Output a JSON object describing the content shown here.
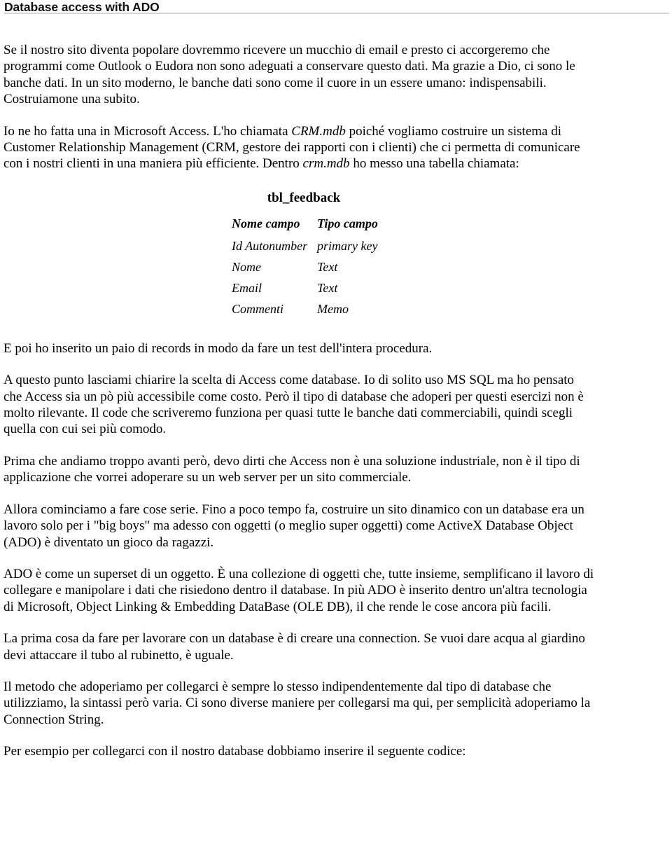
{
  "header": {
    "title": "Database access with ADO",
    "rule_color": "#d4d4d4"
  },
  "document": {
    "paragraphs": [
      {
        "id": "intro",
        "runs": [
          {
            "text": "Se il nostro sito diventa popolare dovremmo ricevere un mucchio di email e presto ci accorgeremo che programmi come Outlook o Eudora non sono adeguati a conservare questo dati. Ma grazie a Dio, ci sono le banche dati. In un sito moderno, le banche dati sono come il cuore in un essere umano: indispensabili. Costruiamone una subito.",
            "style": "normal"
          }
        ]
      },
      {
        "id": "crm-mdb",
        "runs": [
          {
            "text": "Io ne ho fatta una in Microsoft Access. L'ho chiamata ",
            "style": "normal"
          },
          {
            "text": "CRM.mdb",
            "style": "italic"
          },
          {
            "text": " poiché vogliamo costruire un sistema di Customer Relationship Management (CRM, gestore dei rapporti con i clienti) che ci permetta di comunicare con i nostri clienti in una maniera più efficiente. Dentro ",
            "style": "normal"
          },
          {
            "text": "crm.mdb",
            "style": "italic"
          },
          {
            "text": " ho messo una tabella chiamata:",
            "style": "normal"
          }
        ]
      }
    ],
    "paragraphs_after_table": [
      {
        "id": "records-test",
        "runs": [
          {
            "text": "E poi ho inserito un paio di records in modo da fare un test dell'intera procedura.",
            "style": "normal"
          }
        ]
      },
      {
        "id": "access-choice",
        "runs": [
          {
            "text": "A questo punto lasciami chiarire la scelta di Access come database. Io di solito uso MS SQL ma ho pensato che Access sia un pò più accessibile come costo. Però il tipo di database che adoperi per questi esercizi non è molto rilevante. Il code che scriveremo funziona per quasi tutte le banche dati commerciabili, quindi scegli quella con cui sei più comodo.",
            "style": "normal"
          }
        ]
      },
      {
        "id": "access-not-industrial",
        "runs": [
          {
            "text": "Prima che andiamo troppo avanti però, devo dirti che Access non è una soluzione industriale, non è il tipo di applicazione che vorrei adoperare su un web server per un sito commerciale.",
            "style": "normal"
          }
        ]
      },
      {
        "id": "cose-serie",
        "runs": [
          {
            "text": "Allora cominciamo a fare cose serie. Fino a poco tempo fa, costruire un sito dinamico con un database era un lavoro solo per i \"big boys\" ma adesso con oggetti (o meglio super oggetti) come ActiveX Database Object (ADO) è diventato un gioco da ragazzi.",
            "style": "normal"
          }
        ]
      },
      {
        "id": "ado-superset",
        "runs": [
          {
            "text": "ADO è come un superset di un oggetto. È una collezione di oggetti che, tutte insieme, semplificano il lavoro di collegare e manipolare i dati che risiedono dentro il database. In più ADO è inserito dentro un'altra tecnologia di Microsoft, Object Linking & Embedding DataBase (OLE DB), il che rende le cose ancora più facili.",
            "style": "normal"
          }
        ]
      },
      {
        "id": "connection",
        "runs": [
          {
            "text": "La prima cosa da fare per lavorare con un database è di creare una connection. Se vuoi dare acqua al giardino devi attaccare il tubo al rubinetto, è uguale.",
            "style": "normal"
          }
        ]
      },
      {
        "id": "connection-string",
        "runs": [
          {
            "text": "Il metodo che adoperiamo per collegarci è sempre lo stesso indipendentemente dal tipo di database che utilizziamo, la sintassi però varia. Ci sono diverse maniere per collegarsi ma qui, per semplicità adoperiamo la Connection String.",
            "style": "normal"
          }
        ]
      },
      {
        "id": "esempio-codice",
        "runs": [
          {
            "text": "Per esempio per collegarci con il nostro database dobbiamo inserire il seguente codice:",
            "style": "normal"
          }
        ]
      }
    ]
  },
  "field_table": {
    "title": "tbl_feedback",
    "headers": [
      "Nome campo",
      "Tipo campo"
    ],
    "rows": [
      [
        "Id Autonumber",
        "primary key"
      ],
      [
        "Nome",
        "Text"
      ],
      [
        "Email",
        "Text"
      ],
      [
        "Commenti",
        "Memo"
      ]
    ]
  }
}
